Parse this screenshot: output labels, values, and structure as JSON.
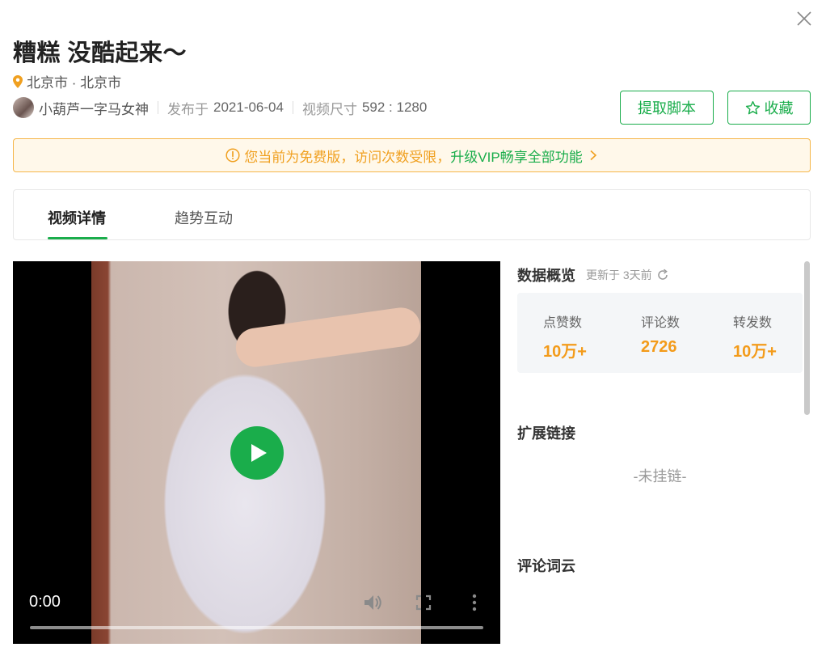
{
  "header": {
    "title": "糟糕 没酷起来～",
    "location": "北京市 · 北京市",
    "author": "小葫芦一字马女神",
    "published_label": "发布于",
    "published_date": "2021-06-04",
    "size_label": "视频尺寸",
    "size_value": "592 : 1280"
  },
  "actions": {
    "extract_script": "提取脚本",
    "favorite": "收藏"
  },
  "notice": {
    "text_before": "您当前为免费版，访问次数受限，",
    "vip_text": "升级VIP畅享全部功能"
  },
  "tabs": [
    {
      "label": "视频详情",
      "active": true
    },
    {
      "label": "趋势互动",
      "active": false
    }
  ],
  "video": {
    "current_time": "0:00",
    "progress": 0
  },
  "overview": {
    "title": "数据概览",
    "updated": "更新于 3天前",
    "stats": [
      {
        "label": "点赞数",
        "value": "10万+"
      },
      {
        "label": "评论数",
        "value": "2726"
      },
      {
        "label": "转发数",
        "value": "10万+"
      }
    ]
  },
  "links": {
    "title": "扩展链接",
    "empty": "-未挂链-"
  },
  "wordcloud": {
    "title": "评论词云"
  },
  "colors": {
    "accent": "#1aad4b",
    "stat_value": "#f39b1a",
    "notice_text": "#f0a020",
    "notice_bg": "#fff8ea"
  },
  "icons": [
    "close-icon",
    "location-pin-icon",
    "avatar",
    "star-icon",
    "warning-circle-icon",
    "chevron-right-icon",
    "play-icon",
    "volume-icon",
    "fullscreen-icon",
    "more-vertical-icon",
    "refresh-icon"
  ]
}
